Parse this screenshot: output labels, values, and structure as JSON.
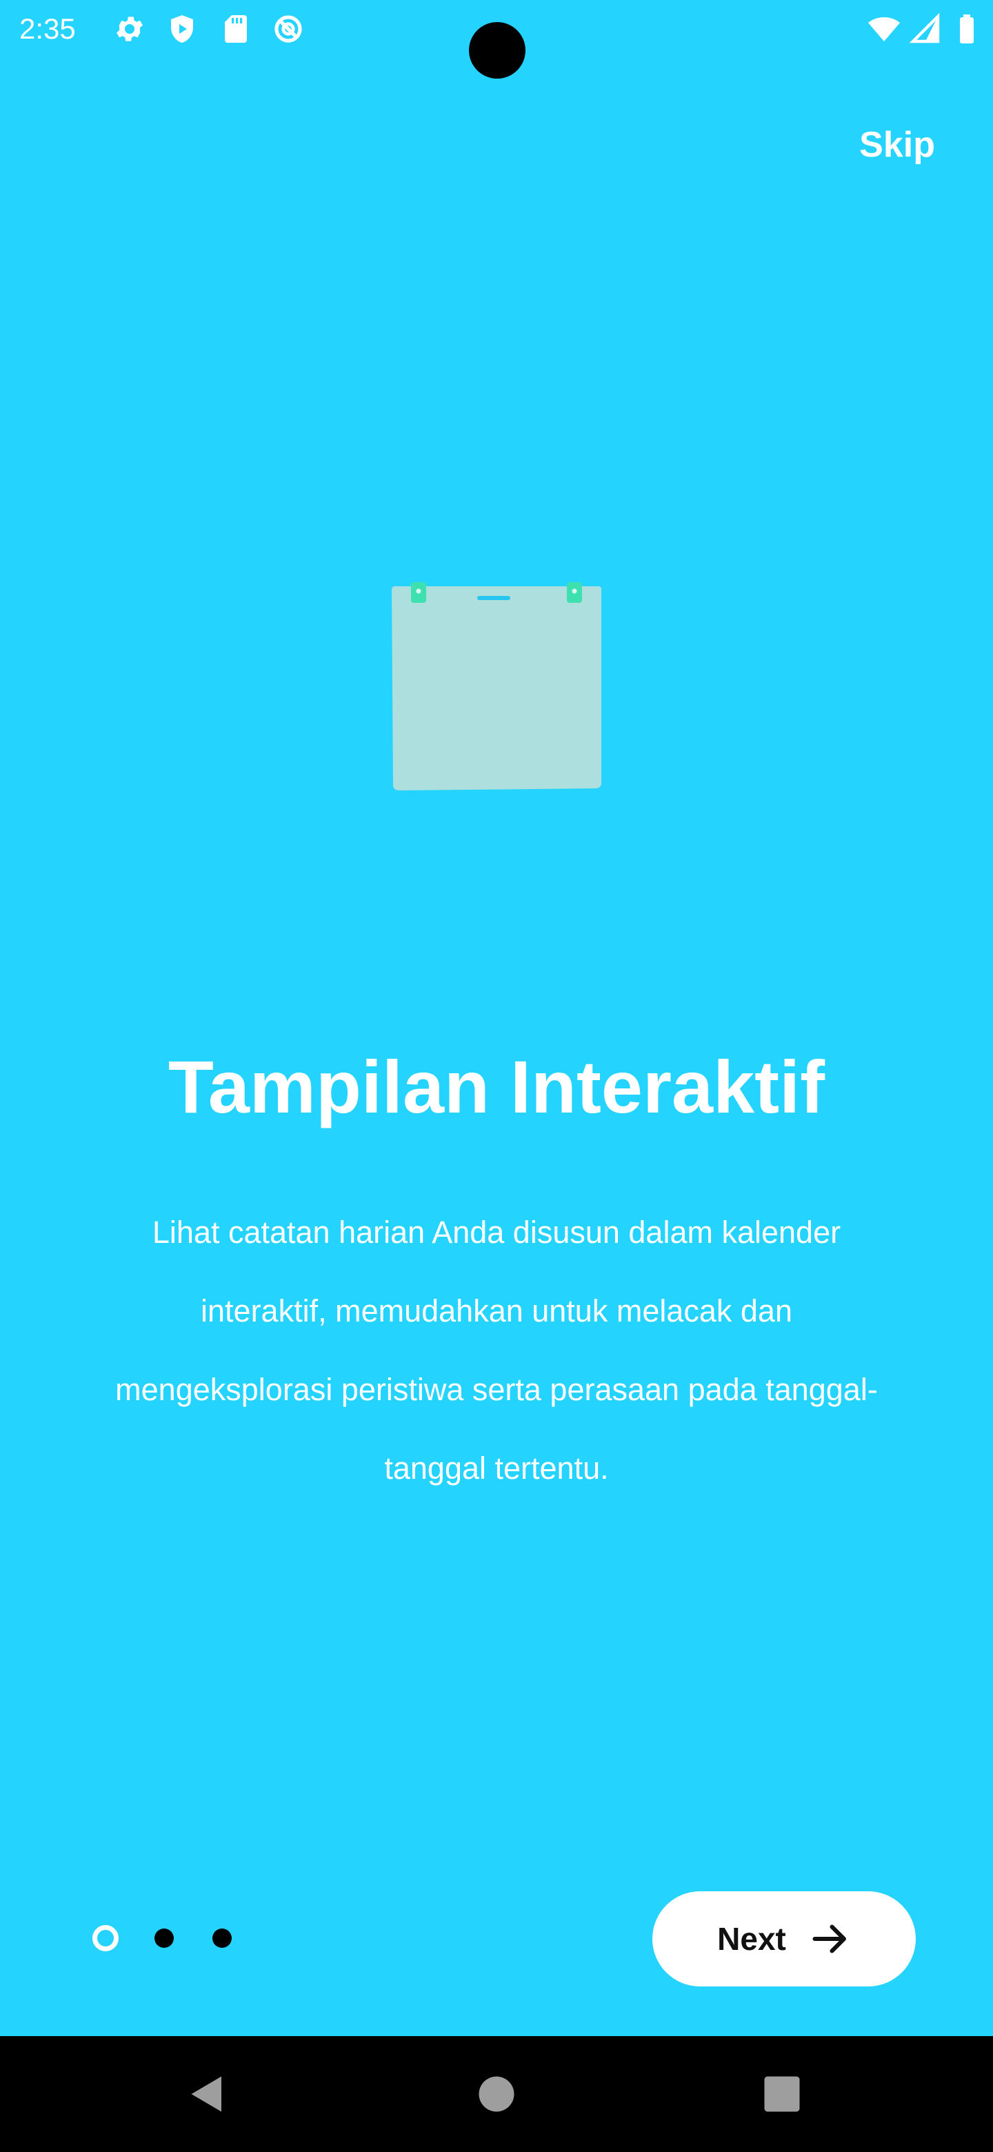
{
  "status_bar": {
    "time": "2:35",
    "icons": [
      "gear-icon",
      "shield-play-icon",
      "sd-card-icon",
      "no-disturb-icon",
      "wifi-icon",
      "signal-icon",
      "battery-icon"
    ]
  },
  "colors": {
    "background": "#24d3fe",
    "button_bg": "#ffffff",
    "button_text": "#111111",
    "dot_inactive": "#000000",
    "dot_active": "#ffffff",
    "nav_bar": "#000000",
    "illustration_paper": "#acdfdd",
    "illustration_pin": "#3fe0b0"
  },
  "header": {
    "skip_label": "Skip"
  },
  "illustration": {
    "icon": "calendar-notepad-illustration"
  },
  "onboarding": {
    "title": "Tampilan Interaktif",
    "description": "Lihat catatan harian Anda disusun dalam kalender interaktif, memudahkan untuk melacak dan mengeksplorasi peristiwa serta perasaan pada tanggal-tanggal tertentu."
  },
  "pagination": {
    "total_pages": 3,
    "current_page": 1
  },
  "footer": {
    "next_label": "Next",
    "next_icon": "arrow-right-icon"
  },
  "nav_bar": {
    "icons": [
      "back-icon",
      "home-icon",
      "recents-icon"
    ]
  }
}
